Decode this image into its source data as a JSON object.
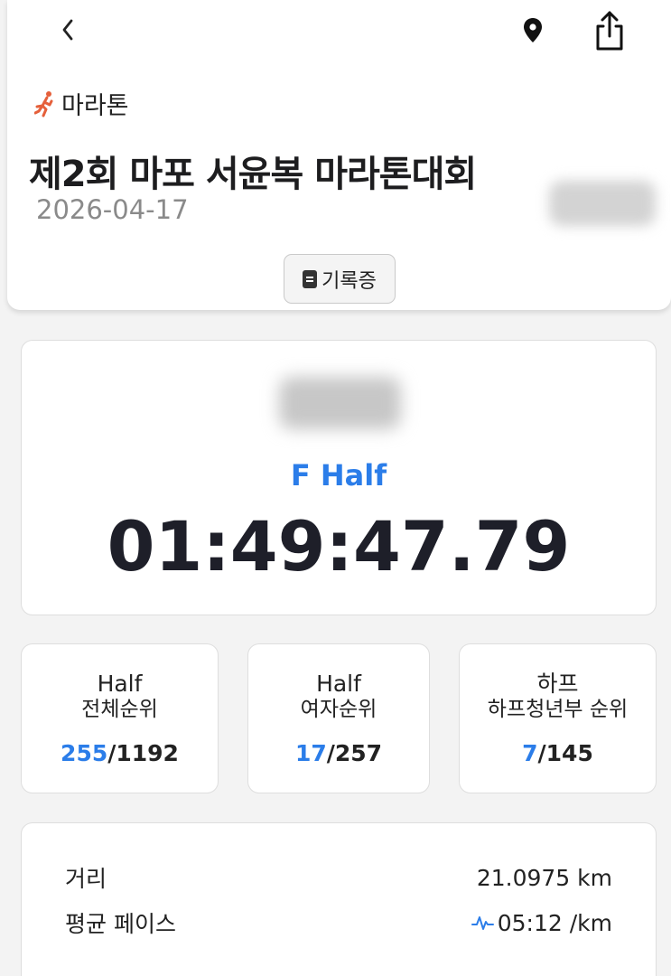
{
  "header": {
    "category": "마라톤",
    "title": "제2회 마포 서윤복 마라톤대회",
    "date": "2026-04-17",
    "certificate_button": "기록증",
    "icons": {
      "back": "chevron-left-icon",
      "location": "map-pin-icon",
      "share": "share-icon",
      "category": "running-person-icon",
      "certificate": "document-icon"
    }
  },
  "result": {
    "course": "F Half",
    "finish_time": "01:49:47.79"
  },
  "ranks": [
    {
      "title": "Half",
      "subtitle": "전체순위",
      "rank": "255",
      "total": "/1192"
    },
    {
      "title": "Half",
      "subtitle": "여자순위",
      "rank": "17",
      "total": "/257"
    },
    {
      "title": "하프",
      "subtitle": "하프청년부 순위",
      "rank": "7",
      "total": "/145"
    }
  ],
  "stats": {
    "distance_label": "거리",
    "distance_value": "21.0975 km",
    "pace_label": "평균 페이스",
    "pace_value": "05:12 /km"
  },
  "colors": {
    "accent": "#2b7de9",
    "category_icon": "#e5603b",
    "text": "#222222",
    "muted": "#8a8a8a"
  }
}
